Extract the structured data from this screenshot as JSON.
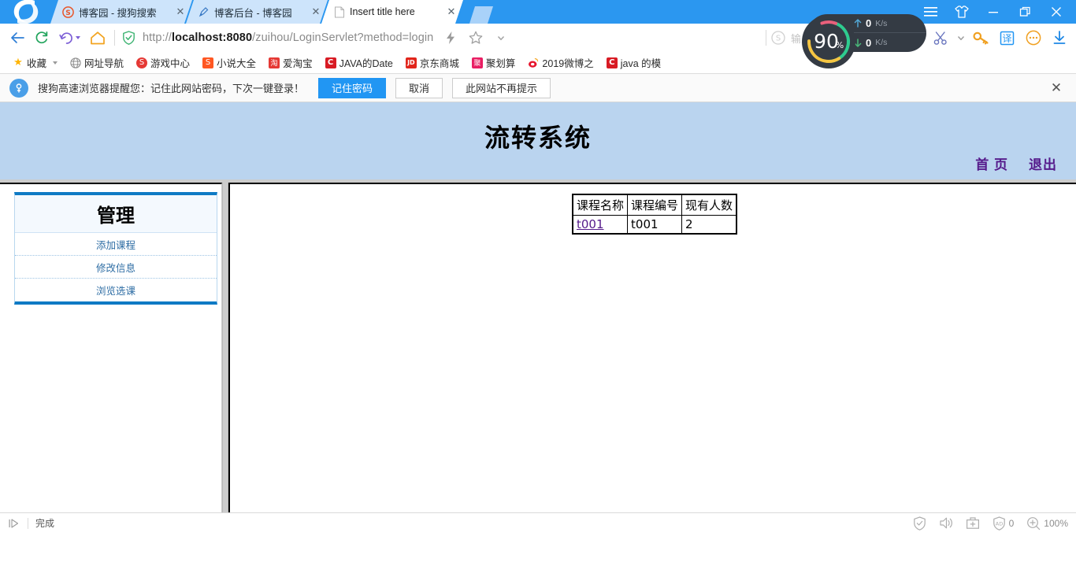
{
  "browser": {
    "tabs": [
      {
        "title": "博客园 - 搜狗搜索",
        "favicon": "sogou-s-icon",
        "active": false,
        "close_label": "✕"
      },
      {
        "title": "博客后台 - 博客园",
        "favicon": "blog-pen-icon",
        "active": false,
        "close_label": "✕"
      },
      {
        "title": "Insert title here",
        "favicon": "blank-page-icon",
        "active": true,
        "close_label": "✕"
      }
    ],
    "window_controls": {
      "menu": "☰",
      "skin": "skin-icon",
      "minimize": "—",
      "restore": "❐",
      "close": "✕"
    },
    "nav": {
      "back": "back-arrow-icon",
      "reload": "reload-icon",
      "history": "history-arrow-icon",
      "home": "home-icon",
      "url_prefix": "http://",
      "url_host": "localhost:8080",
      "url_path": "/zuihou/LoginServlet?method=login",
      "url_full": "http://localhost:8080/zuihou/LoginServlet?method=login",
      "lock": "shield-check-icon",
      "lightning": "lightning-icon",
      "star": "star-icon",
      "star_caret": "▾"
    },
    "search": {
      "placeholder": "输入文字搜索",
      "engine_icon": "sogou-s-icon"
    },
    "speed": {
      "gauge_value": "90",
      "gauge_unit": "%",
      "upload_value": "0",
      "upload_unit": "K/s",
      "download_value": "0",
      "download_unit": "K/s",
      "gauge_colors": [
        "#e9607b",
        "#2ecc8f",
        "#f5c542"
      ]
    },
    "toolbar_icons": [
      {
        "name": "scissors-icon",
        "glyph": "✄",
        "color": "#6a76bf"
      },
      {
        "name": "scissors-caret-icon",
        "glyph": "▾",
        "color": "#8a8a8a"
      },
      {
        "name": "key-icon",
        "glyph": "key",
        "color": "#f5a623"
      },
      {
        "name": "translate-icon",
        "glyph": "译",
        "color": "#2196f3"
      },
      {
        "name": "more-dots-icon",
        "glyph": "···",
        "color": "#f5a623"
      },
      {
        "name": "download-icon",
        "glyph": "↓",
        "color": "#1e88e5"
      }
    ],
    "bookmarks": [
      {
        "label": "收藏",
        "icon": "star-icon",
        "icon_char": "★",
        "color": "#ffb400",
        "bg": "transparent",
        "caret": true
      },
      {
        "label": "网址导航",
        "icon": "globe-icon",
        "icon_char": "⊕",
        "color": "#8a8a8a",
        "bg": "transparent",
        "caret": false
      },
      {
        "label": "游戏中心",
        "icon": "sogou-game-icon",
        "icon_char": "S",
        "color": "#ffffff",
        "bg": "#e53935",
        "caret": false
      },
      {
        "label": "小说大全",
        "icon": "novel-icon",
        "icon_char": "S",
        "color": "#ffffff",
        "bg": "#ff5722",
        "caret": false
      },
      {
        "label": "爱淘宝",
        "icon": "taobao-icon",
        "icon_char": "淘",
        "color": "#ffffff",
        "bg": "#e53935",
        "caret": false
      },
      {
        "label": "JAVA的Date",
        "icon": "csdn-c-icon",
        "icon_char": "C",
        "color": "#ffffff",
        "bg": "#d81b24",
        "caret": false
      },
      {
        "label": "京东商城",
        "icon": "jd-icon",
        "icon_char": "JD",
        "color": "#ffffff",
        "bg": "#e1251b",
        "caret": false
      },
      {
        "label": "聚划算",
        "icon": "juhuasuan-icon",
        "icon_char": "聚",
        "color": "#ffffff",
        "bg": "#e91e63",
        "caret": false
      },
      {
        "label": "2019微博之",
        "icon": "weibo-icon",
        "icon_char": "◉",
        "color": "#ffffff",
        "bg": "#e6162d",
        "caret": false
      },
      {
        "label": "java 的模",
        "icon": "csdn-c-icon",
        "icon_char": "C",
        "color": "#ffffff",
        "bg": "#d81b24",
        "caret": false
      }
    ],
    "notification": {
      "icon": "key-circle-icon",
      "message": "搜狗高速浏览器提醒您：记住此网站密码，下次一键登录！",
      "primary_button": "记住密码",
      "secondary_button": "取消",
      "tertiary_button": "此网站不再提示",
      "close": "✕",
      "primary_color": "#2196f3"
    },
    "statusbar": {
      "play_icon": "play-pointer-icon",
      "text": "完成",
      "shield_icon": "shield-icon",
      "sound_icon": "sound-icon",
      "toolbox_icon": "toolbox-icon",
      "ad_icon": "ad-block-icon",
      "ad_count": "0",
      "zoom_icon": "zoom-in-icon",
      "zoom_level": "100%"
    }
  },
  "webpage": {
    "header": {
      "title": "流转系统",
      "bg_color": "#bad4ef",
      "nav_links": [
        {
          "label": "首 页"
        },
        {
          "label": "退出"
        }
      ],
      "link_color": "#551a8b"
    },
    "sidebar": {
      "heading": "管理",
      "accent_color": "#0e7ac4",
      "items": [
        {
          "label": "添加课程"
        },
        {
          "label": "修改信息"
        },
        {
          "label": "浏览选课"
        }
      ]
    },
    "table": {
      "headers": [
        "课程名称",
        "课程编号",
        "现有人数"
      ],
      "rows": [
        {
          "name": "t001",
          "code": "t001",
          "count": "2",
          "name_is_link": true
        }
      ]
    }
  }
}
